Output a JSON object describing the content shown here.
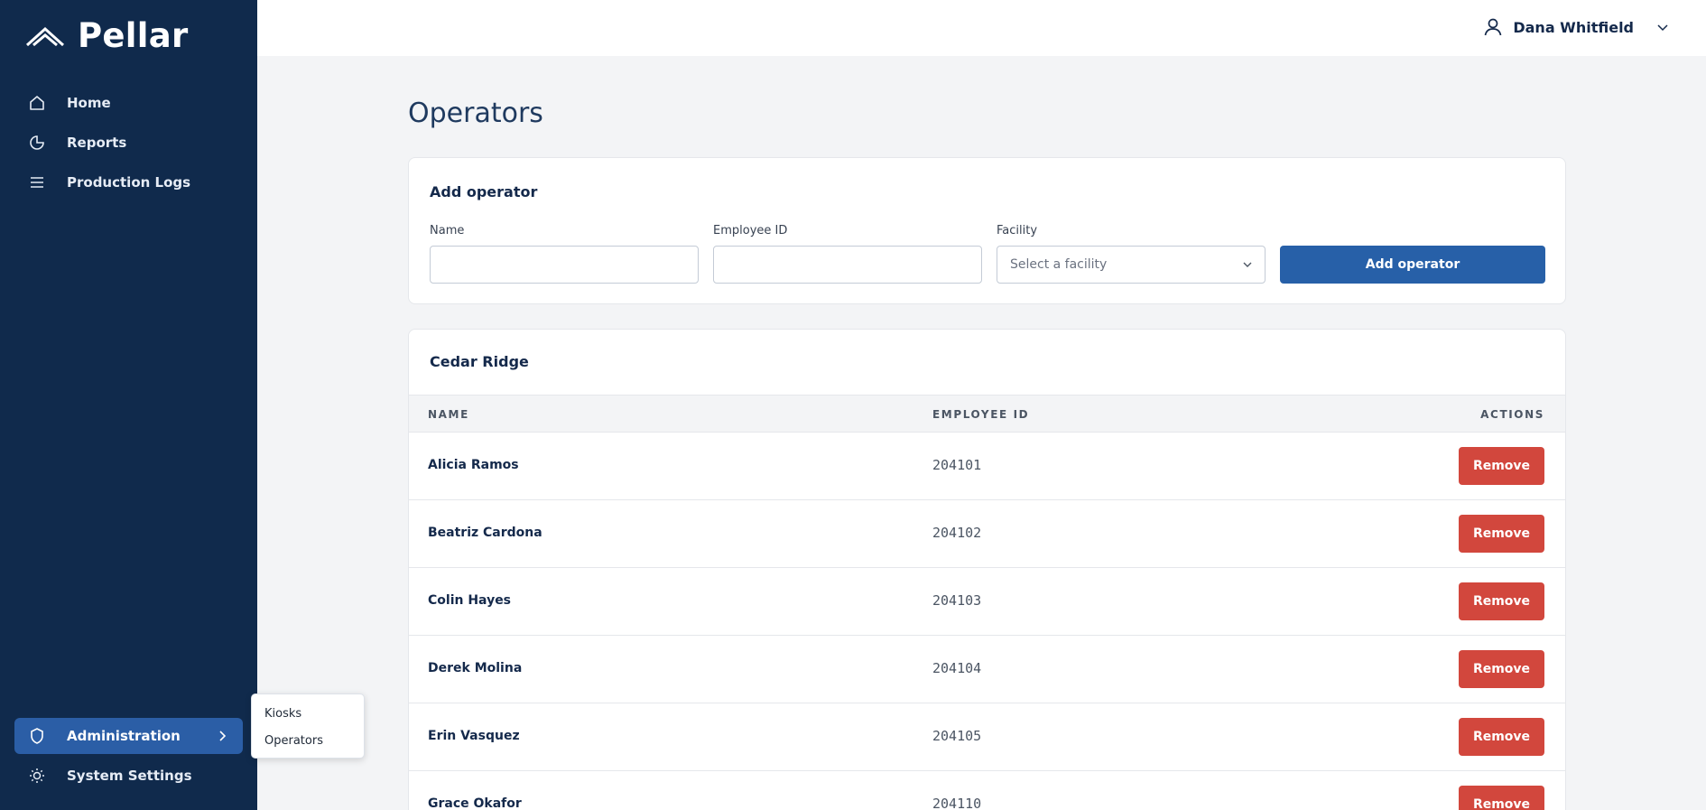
{
  "app": {
    "name": "Pellar"
  },
  "sidebar": {
    "items": [
      {
        "label": "Home",
        "icon": "home-icon"
      },
      {
        "label": "Reports",
        "icon": "pie-chart-icon"
      },
      {
        "label": "Production Logs",
        "icon": "list-icon"
      }
    ],
    "admin": {
      "label": "Administration",
      "icon": "shield-icon",
      "active": true
    },
    "settings": {
      "label": "System Settings",
      "icon": "sun-icon"
    },
    "flyout": [
      "Kiosks",
      "Operators"
    ]
  },
  "header": {
    "user_name": "Dana Whitfield"
  },
  "page": {
    "title": "Operators"
  },
  "add_form": {
    "title": "Add operator",
    "name_label": "Name",
    "name_value": "",
    "employee_id_label": "Employee ID",
    "employee_id_value": "",
    "facility_label": "Facility",
    "facility_placeholder": "Select a facility",
    "submit_label": "Add operator"
  },
  "facility_group": {
    "title": "Cedar Ridge",
    "columns": [
      "NAME",
      "EMPLOYEE ID",
      "ACTIONS"
    ],
    "rows": [
      {
        "name": "Alicia Ramos",
        "employee_id": "204101",
        "action": "Remove"
      },
      {
        "name": "Beatriz Cardona",
        "employee_id": "204102",
        "action": "Remove"
      },
      {
        "name": "Colin Hayes",
        "employee_id": "204103",
        "action": "Remove"
      },
      {
        "name": "Derek Molina",
        "employee_id": "204104",
        "action": "Remove"
      },
      {
        "name": "Erin Vasquez",
        "employee_id": "204105",
        "action": "Remove"
      },
      {
        "name": "Grace Okafor",
        "employee_id": "204110",
        "action": "Remove"
      }
    ]
  },
  "colors": {
    "sidebar_bg": "#102a4c",
    "active_nav": "#2b5ea6",
    "primary_button": "#2760a8",
    "danger_button": "#d2473d"
  }
}
